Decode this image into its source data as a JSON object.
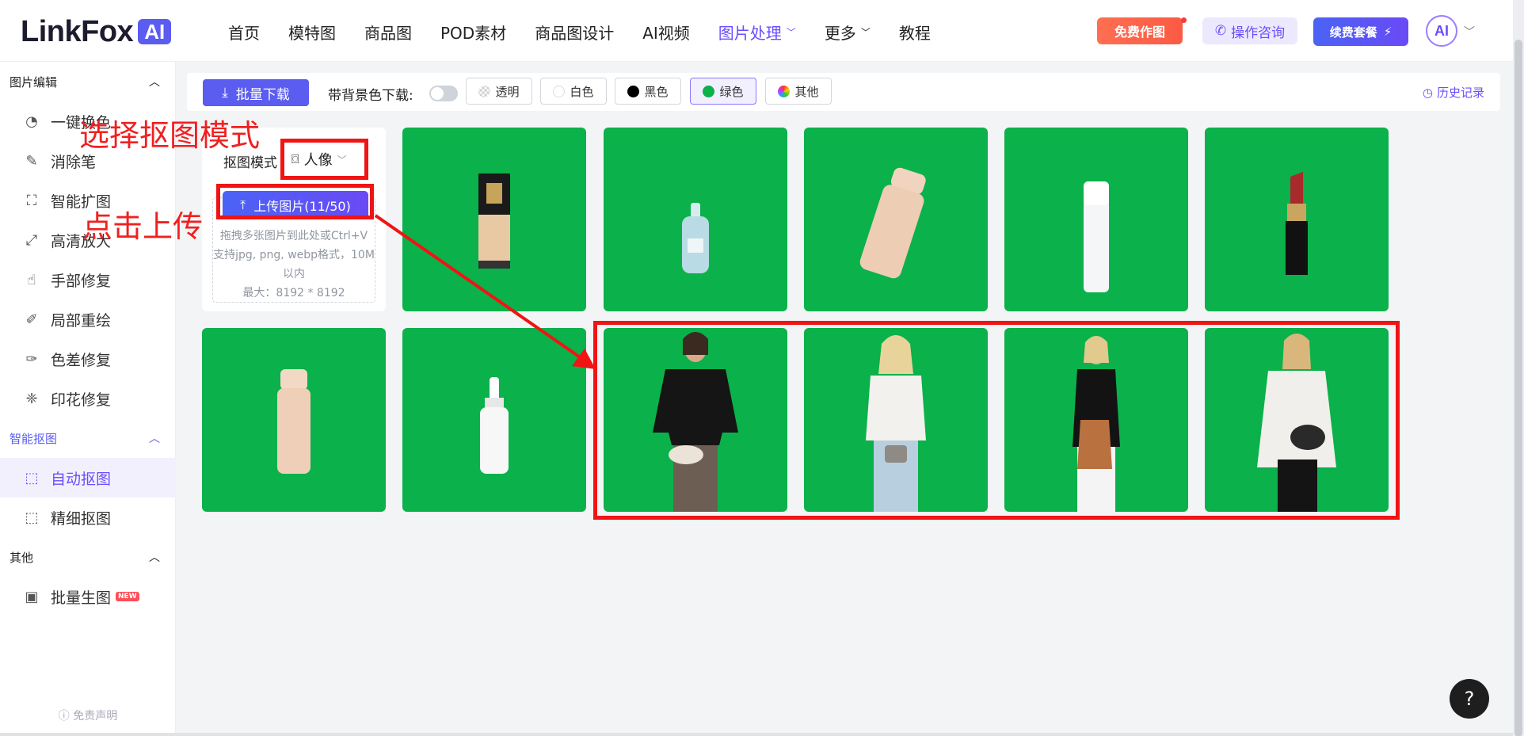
{
  "brand": {
    "logo_text": "LinkFox",
    "logo_ai": "AI"
  },
  "nav": {
    "items": [
      "首页",
      "模特图",
      "商品图",
      "POD素材",
      "商品图设计",
      "AI视频",
      "图片处理",
      "更多",
      "教程"
    ],
    "active": "图片处理"
  },
  "header": {
    "free_btn": "免费作图",
    "consult_btn": "操作咨询",
    "renew_btn": "续费套餐",
    "avatar_text": "AI"
  },
  "sidebar": {
    "sections": [
      {
        "title": "图片编辑",
        "items": [
          "一键换色",
          "消除笔",
          "智能扩图",
          "高清放大",
          "手部修复",
          "局部重绘",
          "色差修复",
          "印花修复"
        ]
      },
      {
        "title": "智能抠图",
        "items": [
          "自动抠图",
          "精细抠图"
        ]
      },
      {
        "title": "其他",
        "items": [
          "批量生图"
        ]
      }
    ],
    "active_item": "自动抠图",
    "new_badge": "NEW",
    "disclaimer": "免责声明"
  },
  "toolbar": {
    "batch_download": "批量下载",
    "bg_download_label": "带背景色下载:",
    "bg_options": [
      {
        "label": "透明",
        "color": "transparent"
      },
      {
        "label": "白色",
        "color": "#ffffff"
      },
      {
        "label": "黑色",
        "color": "#000000"
      },
      {
        "label": "绿色",
        "color": "#0bb14a"
      },
      {
        "label": "其他",
        "color": "multi"
      }
    ],
    "selected_bg": "绿色",
    "history": "历史记录"
  },
  "upload": {
    "mode_label": "抠图模式",
    "mode_value": "人像",
    "upload_btn": "上传图片(11/50)",
    "hint_lines": [
      "拖拽多张图片到此处或Ctrl+V",
      "支持jpg, png, webp格式，10M",
      "以内",
      "最大：8192 * 8192"
    ]
  },
  "gallery": {
    "background": "#0bb14a",
    "items": [
      {
        "kind": "foundation-bottle"
      },
      {
        "kind": "serum-dropper"
      },
      {
        "kind": "foundation-tilted"
      },
      {
        "kind": "white-tube"
      },
      {
        "kind": "lipstick"
      },
      {
        "kind": "foundation-beige"
      },
      {
        "kind": "serum-white"
      },
      {
        "kind": "model-black-sweater"
      },
      {
        "kind": "model-white-top"
      },
      {
        "kind": "model-back-view"
      },
      {
        "kind": "model-white-shirt"
      }
    ]
  },
  "annotations": {
    "select_mode": "选择抠图模式",
    "click_upload": "点击上传",
    "color": "#f01414"
  },
  "help_label": "?"
}
